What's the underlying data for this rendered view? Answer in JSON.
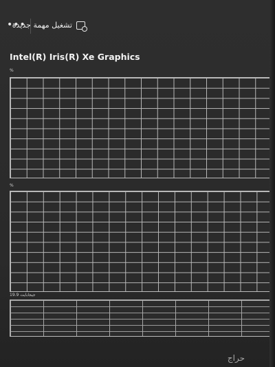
{
  "toolbar": {
    "run_new_task_label": "تشغيل مهمة جديدة",
    "run_new_task_icon": "run-task-icon",
    "more_label": "•••",
    "more_icon": "more-options-icon"
  },
  "gpu": {
    "name": "Intel(R) Iris(R) Xe Graphics",
    "graph1_label": "%",
    "graph2_label": "%",
    "graph3_label": "19.9 جيجابايت"
  },
  "watermark": {
    "text": "حراج"
  },
  "colors": {
    "background": "#2b2b2b",
    "grid_line": "#b8b8b8",
    "text": "#e6e6e6"
  }
}
